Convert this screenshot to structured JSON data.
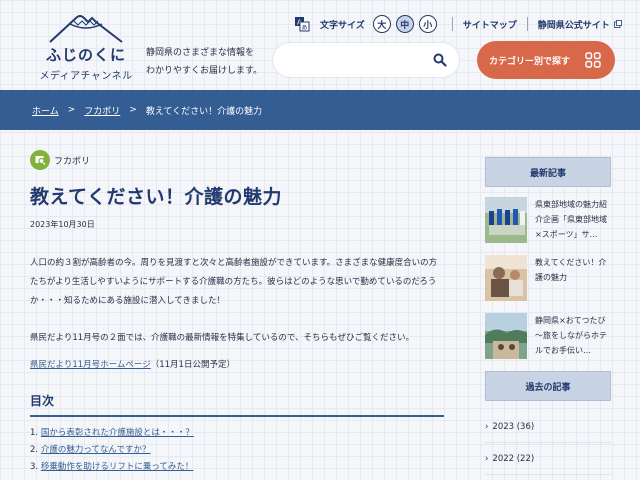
{
  "brand": {
    "logo_line1": "ふじのくに",
    "logo_line2": "メディアチャンネル",
    "tagline_line1": "静岡県のさまざまな情報を",
    "tagline_line2": "わかりやすくお届けします。"
  },
  "utility": {
    "font_size_label": "文字サイズ",
    "size_large": "大",
    "size_medium": "中",
    "size_small": "小",
    "sitemap": "サイトマップ",
    "official_site": "静岡県公式サイト"
  },
  "search": {
    "placeholder": ""
  },
  "category_button": "カテゴリー別で探す",
  "breadcrumb": {
    "home": "ホーム",
    "section": "フカボリ",
    "current": "教えてください！介護の魅力"
  },
  "article": {
    "category": "フカボリ",
    "title": "教えてください！介護の魅力",
    "date": "2023年10月30日",
    "para1": "人口の約３割が高齢者の今。周りを見渡すと次々と高齢者施設ができています。さまざまな健康度合いの方たちがより生活しやすいようにサポートする介護職の方たち。彼らはどのような思いで勤めているのだろうか・・・知るためにある施設に潜入してきました！",
    "para2": "県民だより11月号の２面では、介護職の最新情報を特集しているので、そちらもぜひご覧ください。",
    "link_text": "県民だより11月号ホームページ",
    "link_note": "（11月1日公開予定）",
    "toc_title": "目次",
    "toc": [
      {
        "num": "1.",
        "text": "国から表彰された介護施設とは・・・？"
      },
      {
        "num": "2.",
        "text": "介護の魅力ってなんですか？"
      },
      {
        "num": "3.",
        "text": "移乗動作を助けるリフトに乗ってみた！"
      }
    ]
  },
  "sidebar": {
    "recent_title": "最新記事",
    "recent": [
      {
        "title": "県東部地域の魅力紹介企画「県東部地域×スポーツ」サ…"
      },
      {
        "title": "教えてください！介護の魅力"
      },
      {
        "title": "静岡県×おてつたび　～旅をしながらホテルでお手伝い…"
      }
    ],
    "archive_title": "過去の記事",
    "archive": [
      {
        "label": "2023 (36)"
      },
      {
        "label": "2022 (22)"
      }
    ]
  },
  "colors": {
    "navy": "#233a6e",
    "breadcrumb_bg": "#345d94",
    "accent_button": "#d7684a",
    "category_green": "#7fb33a"
  }
}
